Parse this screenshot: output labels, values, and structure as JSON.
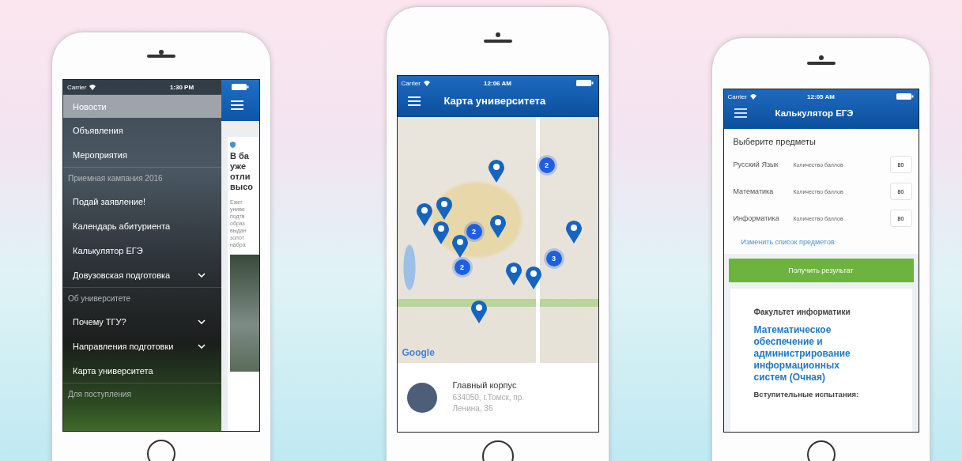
{
  "phones": [
    {
      "kind": "menu",
      "status": {
        "carrier": "Carrier",
        "time": "1:30 PM"
      },
      "menu": [
        {
          "kind": "item",
          "label": "Новости",
          "selected": true,
          "expandable": false
        },
        {
          "kind": "item",
          "label": "Объявления",
          "selected": false,
          "expandable": false
        },
        {
          "kind": "item",
          "label": "Мероприятия",
          "selected": false,
          "expandable": false
        },
        {
          "kind": "header",
          "label": "Приемная кампания 2016",
          "selected": false,
          "expandable": false
        },
        {
          "kind": "item",
          "label": "Подай заявление!",
          "selected": false,
          "expandable": false
        },
        {
          "kind": "item",
          "label": "Календарь абитуриента",
          "selected": false,
          "expandable": false
        },
        {
          "kind": "item",
          "label": "Калькулятор ЕГЭ",
          "selected": false,
          "expandable": false
        },
        {
          "kind": "item",
          "label": "Довузовская подготовка",
          "selected": false,
          "expandable": true
        },
        {
          "kind": "header",
          "label": "Об университете",
          "selected": false,
          "expandable": false
        },
        {
          "kind": "item",
          "label": "Почему ТГУ?",
          "selected": false,
          "expandable": true
        },
        {
          "kind": "item",
          "label": "Направления подготовки",
          "selected": false,
          "expandable": true
        },
        {
          "kind": "item",
          "label": "Карта университета",
          "selected": false,
          "expandable": false
        },
        {
          "kind": "header",
          "label": "Для поступления",
          "selected": false,
          "expandable": false
        }
      ],
      "news_card": {
        "title_lines": [
          "В ба",
          "уже",
          "отли",
          "высо"
        ],
        "body_lines": [
          "Ежег",
          "униве",
          "подтв",
          "образ",
          "выдан",
          "золот",
          "набра"
        ]
      }
    },
    {
      "kind": "map",
      "status": {
        "carrier": "Carrier",
        "time": "12:06 AM"
      },
      "title": "Карта университета",
      "clusters": [
        "2",
        "2",
        "2",
        "3"
      ],
      "map_attribution": "Google",
      "place": {
        "name": "Главный корпус",
        "address": "634050, г.Томск, пр. Ленина, 36"
      }
    },
    {
      "kind": "calculator",
      "status": {
        "carrier": "Carrier",
        "time": "12:05 AM"
      },
      "title": "Калькулятор ЕГЭ",
      "section_title": "Выберите предметы",
      "subjects": [
        {
          "name": "Русский Язык",
          "score_label": "Количество баллов",
          "score": "80"
        },
        {
          "name": "Математика",
          "score_label": "Количество баллов",
          "score": "80"
        },
        {
          "name": "Информатика",
          "score_label": "Количество баллов",
          "score": "80"
        }
      ],
      "change_link": "Изменить список предметов",
      "submit_button": "Получить результат",
      "result": {
        "faculty": "Факультет информатики",
        "program": "Математическое обеспечение и администрирование информационных систем (Очная)",
        "exams_label": "Вступительные испытания:"
      }
    }
  ]
}
